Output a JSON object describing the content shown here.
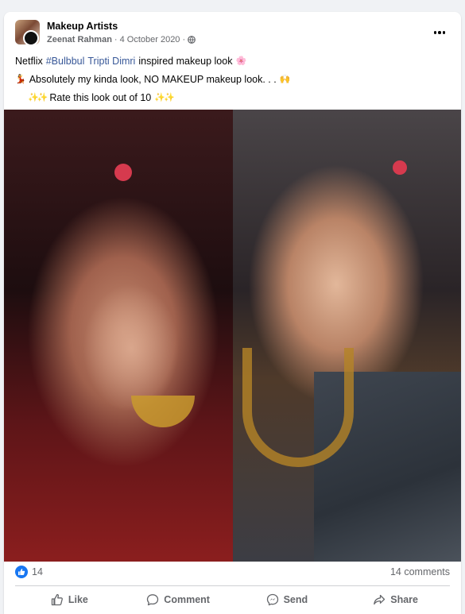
{
  "post": {
    "group_name": "Makeup Artists",
    "author": "Zeenat Rahman",
    "separator": "·",
    "date": "4 October 2020",
    "visibility_icon": "globe-icon",
    "more_icon": "more-options-icon"
  },
  "text": {
    "line1_prefix": "Netflix",
    "line1_hashtag": "#Bulbbul",
    "line1_link": "Tripti Dimri",
    "line1_suffix": "inspired makeup look",
    "line1_emoji": "🌸",
    "line2_emoji_start": "💃",
    "line2_text": "Absolutely my kinda look, NO MAKEUP makeup look. . .",
    "line2_emoji_end": "🙌",
    "line3_emoji_start": "✨✨",
    "line3_text": "Rate this look out of 10",
    "line3_emoji_end": "✨✨"
  },
  "photo": {
    "description_icon": "post-photo"
  },
  "stats": {
    "likes": "14",
    "comments": "14 comments"
  },
  "actions": {
    "like": "Like",
    "comment": "Comment",
    "send": "Send",
    "share": "Share"
  },
  "colors": {
    "accent": "#1877f2",
    "link": "#385898",
    "secondary_text": "#65676b"
  }
}
